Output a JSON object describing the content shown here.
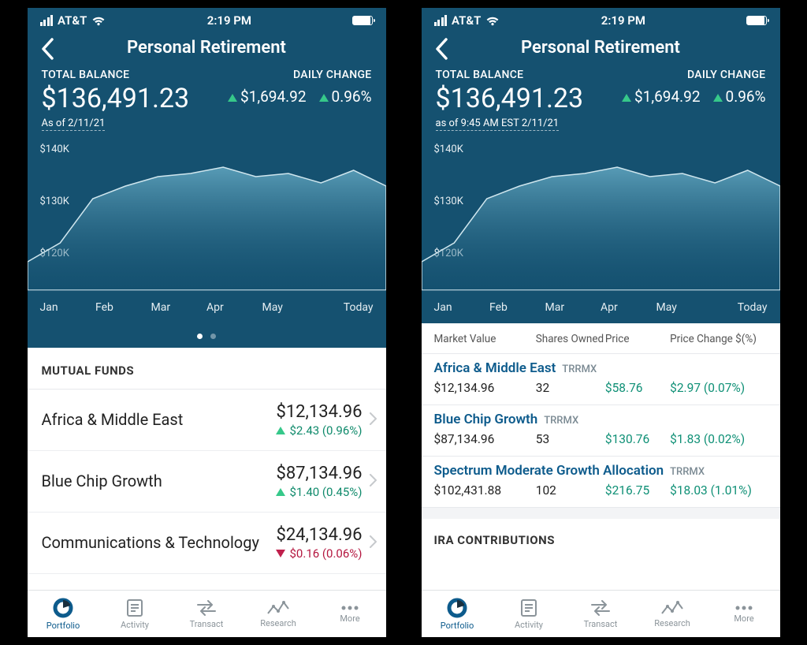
{
  "status": {
    "carrier": "AT&T",
    "time": "2:19 PM"
  },
  "header": {
    "title": "Personal Retirement"
  },
  "balance": {
    "label": "TOTAL BALANCE",
    "value": "$136,491.23",
    "asof_left": "As of 2/11/21",
    "asof_right": "as of 9:45 AM EST 2/11/21",
    "daily_label": "DAILY CHANGE",
    "daily_amount": "$1,694.92",
    "daily_pct": "0.96%"
  },
  "chart_data": {
    "type": "area",
    "xlabel": "",
    "ylabel": "",
    "ylim": [
      120000,
      140000
    ],
    "y_ticks": [
      "$140K",
      "$130K",
      "$120K"
    ],
    "x_ticks": [
      "Jan",
      "Feb",
      "Mar",
      "Apr",
      "May",
      "Today"
    ],
    "series": [
      {
        "name": "Balance",
        "x": [
          "Jan",
          "",
          "Feb",
          "",
          "Mar",
          "",
          "Apr",
          "",
          "May",
          "",
          "Today",
          ""
        ],
        "values": [
          122000,
          125000,
          132000,
          134000,
          135500,
          136000,
          137000,
          135500,
          136000,
          134500,
          136500,
          134000
        ]
      }
    ]
  },
  "left": {
    "section": "MUTUAL FUNDS",
    "funds": [
      {
        "name": "Africa & Middle East",
        "value": "$12,134.96",
        "delta": "$2.43 (0.96%)",
        "dir": "up"
      },
      {
        "name": "Blue Chip Growth",
        "value": "$87,134.96",
        "delta": "$1.40 (0.45%)",
        "dir": "up"
      },
      {
        "name": "Communications & Technology",
        "value": "$24,134.96",
        "delta": "$0.16 (0.06%)",
        "dir": "down"
      }
    ]
  },
  "right": {
    "columns": {
      "mv": "Market Value",
      "sh": "Shares Owned",
      "pr": "Price",
      "pc": "Price Change $(%)"
    },
    "rows": [
      {
        "name": "Africa & Middle East",
        "ticker": "TRRMX",
        "mv": "$12,134.96",
        "sh": "32",
        "pr": "$58.76",
        "pc": "$2.97 (0.07%)"
      },
      {
        "name": "Blue Chip Growth",
        "ticker": "TRRMX",
        "mv": "$87,134.96",
        "sh": "53",
        "pr": "$130.76",
        "pc": "$1.83 (0.02%)"
      },
      {
        "name": "Spectrum Moderate Growth Allocation",
        "ticker": "TRRMX",
        "mv": "$102,431.88",
        "sh": "102",
        "pr": "$216.75",
        "pc": "$18.03 (1.01%)"
      }
    ],
    "ira_header": "IRA CONTRIBUTIONS"
  },
  "tabs": {
    "portfolio": "Portfolio",
    "activity": "Activity",
    "transact": "Transact",
    "research": "Research",
    "more": "More"
  }
}
